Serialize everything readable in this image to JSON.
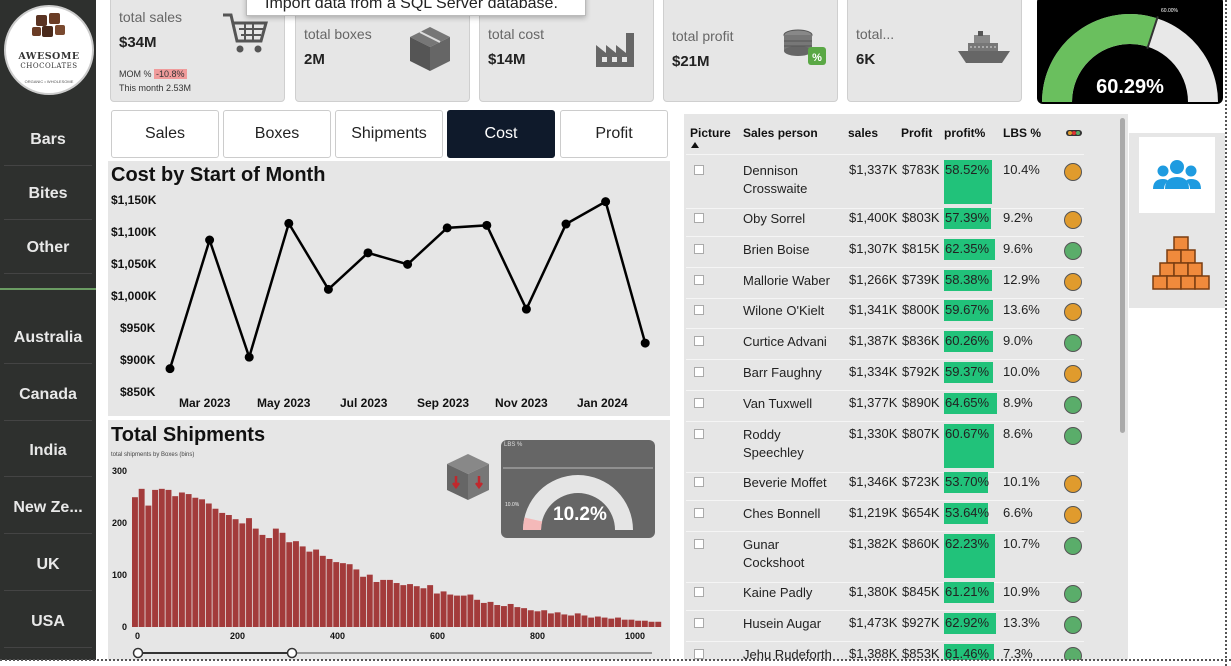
{
  "kpis": {
    "sales": {
      "label": "total sales",
      "value": "$34M",
      "mom_label": "MOM %",
      "mom_value": "-10.8%",
      "month_text": "This month 2.53M",
      "icon": "shopping-cart-icon"
    },
    "boxes": {
      "label": "total boxes",
      "value": "2M",
      "icon": "box-icon"
    },
    "cost": {
      "label": "total cost",
      "value": "$14M",
      "icon": "factory-icon"
    },
    "profit": {
      "label": "total profit",
      "value": "$21M",
      "icon": "coins-icon"
    },
    "shipments": {
      "label": "total...",
      "value": "6K",
      "icon": "ship-icon"
    }
  },
  "tooltip": "Import data from a SQL Server database.",
  "profit_gauge": {
    "value_text": "60.29%",
    "value": 60.29,
    "target_text": "60.00%",
    "fill_color": "#6abf5e"
  },
  "logo": {
    "line1": "AWESOME",
    "line2": "CHOCOLATES",
    "line3": "ORGANIC • WHOLESOME"
  },
  "sidebar": {
    "products": [
      "Bars",
      "Bites",
      "Other"
    ],
    "countries": [
      "Australia",
      "Canada",
      "India",
      "New Ze...",
      "UK",
      "USA"
    ]
  },
  "tabs": [
    {
      "label": "Sales",
      "active": false
    },
    {
      "label": "Boxes",
      "active": false
    },
    {
      "label": "Shipments",
      "active": false
    },
    {
      "label": "Cost",
      "active": true
    },
    {
      "label": "Profit",
      "active": false
    }
  ],
  "cost_chart": {
    "title": "Cost by Start of Month",
    "yticks": [
      "$1,150K",
      "$1,100K",
      "$1,050K",
      "$1,000K",
      "$950K",
      "$900K",
      "$850K"
    ],
    "xticks": [
      "Mar 2023",
      "May 2023",
      "Jul 2023",
      "Sep 2023",
      "Nov 2023",
      "Jan 2024"
    ]
  },
  "shipments_chart": {
    "title": "Total Shipments",
    "subtitle": "total shipments by Boxes (bins)",
    "yticks": [
      "300",
      "200",
      "100",
      "0"
    ],
    "xticks": [
      "0",
      "200",
      "400",
      "600",
      "800",
      "1000"
    ],
    "gauge_label": "LBS %",
    "gauge_value": "10.2%",
    "gauge_min": "10.0%"
  },
  "chart_data": [
    {
      "type": "line",
      "title": "Cost by Start of Month",
      "x": [
        "Feb 2023",
        "Mar 2023",
        "Apr 2023",
        "May 2023",
        "Jun 2023",
        "Jul 2023",
        "Aug 2023",
        "Sep 2023",
        "Oct 2023",
        "Nov 2023",
        "Dec 2023",
        "Jan 2024",
        "Feb 2024"
      ],
      "y": [
        888,
        1089,
        906,
        1115,
        1012,
        1069,
        1051,
        1108,
        1112,
        981,
        1114,
        1149,
        928
      ],
      "y_unit": "$K",
      "ylim": [
        850,
        1150
      ],
      "grid": false,
      "line_color": "#000000"
    },
    {
      "type": "bar",
      "title": "Total Shipments",
      "subtitle": "total shipments by Boxes (bins)",
      "x_range": [
        0,
        1040
      ],
      "values": [
        248,
        264,
        232,
        262,
        264,
        262,
        250,
        257,
        254,
        247,
        244,
        236,
        226,
        218,
        214,
        206,
        198,
        208,
        188,
        176,
        170,
        188,
        180,
        162,
        164,
        154,
        144,
        148,
        136,
        130,
        124,
        122,
        120,
        110,
        96,
        100,
        86,
        90,
        90,
        84,
        80,
        82,
        78,
        74,
        80,
        64,
        68,
        62,
        60,
        60,
        62,
        52,
        46,
        48,
        42,
        40,
        44,
        38,
        36,
        32,
        30,
        32,
        26,
        28,
        24,
        22,
        26,
        22,
        18,
        20,
        18,
        16,
        18,
        14,
        14,
        12,
        12,
        10,
        10
      ],
      "ylim": [
        0,
        300
      ],
      "bar_color": "#a33b3b"
    }
  ],
  "table": {
    "headers": [
      "Picture",
      "Sales person",
      "sales",
      "Profit",
      "profit%",
      "LBS %",
      ""
    ],
    "rows": [
      {
        "name": "Dennison Crosswaite",
        "sales": "$1,337K",
        "profit": "$783K",
        "pct": "58.52%",
        "pct_val": 58.52,
        "lbs": "10.4%",
        "status": "orange"
      },
      {
        "name": "Oby Sorrel",
        "sales": "$1,400K",
        "profit": "$803K",
        "pct": "57.39%",
        "pct_val": 57.39,
        "lbs": "9.2%",
        "status": "orange"
      },
      {
        "name": "Brien Boise",
        "sales": "$1,307K",
        "profit": "$815K",
        "pct": "62.35%",
        "pct_val": 62.35,
        "lbs": "9.6%",
        "status": "green"
      },
      {
        "name": "Mallorie Waber",
        "sales": "$1,266K",
        "profit": "$739K",
        "pct": "58.38%",
        "pct_val": 58.38,
        "lbs": "12.9%",
        "status": "orange"
      },
      {
        "name": "Wilone O'Kielt",
        "sales": "$1,341K",
        "profit": "$800K",
        "pct": "59.67%",
        "pct_val": 59.67,
        "lbs": "13.6%",
        "status": "orange"
      },
      {
        "name": "Curtice Advani",
        "sales": "$1,387K",
        "profit": "$836K",
        "pct": "60.26%",
        "pct_val": 60.26,
        "lbs": "9.0%",
        "status": "green"
      },
      {
        "name": "Barr Faughny",
        "sales": "$1,334K",
        "profit": "$792K",
        "pct": "59.37%",
        "pct_val": 59.37,
        "lbs": "10.0%",
        "status": "orange"
      },
      {
        "name": "Van Tuxwell",
        "sales": "$1,377K",
        "profit": "$890K",
        "pct": "64.65%",
        "pct_val": 64.65,
        "lbs": "8.9%",
        "status": "green"
      },
      {
        "name": "Roddy Speechley",
        "sales": "$1,330K",
        "profit": "$807K",
        "pct": "60.67%",
        "pct_val": 60.67,
        "lbs": "8.6%",
        "status": "green"
      },
      {
        "name": "Beverie Moffet",
        "sales": "$1,346K",
        "profit": "$723K",
        "pct": "53.70%",
        "pct_val": 53.7,
        "lbs": "10.1%",
        "status": "orange"
      },
      {
        "name": "Ches Bonnell",
        "sales": "$1,219K",
        "profit": "$654K",
        "pct": "53.64%",
        "pct_val": 53.64,
        "lbs": "6.6%",
        "status": "orange"
      },
      {
        "name": "Gunar Cockshoot",
        "sales": "$1,382K",
        "profit": "$860K",
        "pct": "62.23%",
        "pct_val": 62.23,
        "lbs": "10.7%",
        "status": "green"
      },
      {
        "name": "Kaine Padly",
        "sales": "$1,380K",
        "profit": "$845K",
        "pct": "61.21%",
        "pct_val": 61.21,
        "lbs": "10.9%",
        "status": "green"
      },
      {
        "name": "Husein Augar",
        "sales": "$1,473K",
        "profit": "$927K",
        "pct": "62.92%",
        "pct_val": 62.92,
        "lbs": "13.3%",
        "status": "green"
      },
      {
        "name": "Jehu Rudeforth",
        "sales": "$1,388K",
        "profit": "$853K",
        "pct": "61.46%",
        "pct_val": 61.46,
        "lbs": "7.3%",
        "status": "green"
      }
    ]
  },
  "right_buttons": [
    "people-icon",
    "boxes-stack-icon"
  ],
  "colors": {
    "accent_dark": "#0f1a2b",
    "status_orange": "#e09b2d",
    "status_green": "#5aad6a",
    "profit_fill": "#21c27a",
    "bar_red": "#a33b3b",
    "sidebar_bg": "#2e302e"
  }
}
